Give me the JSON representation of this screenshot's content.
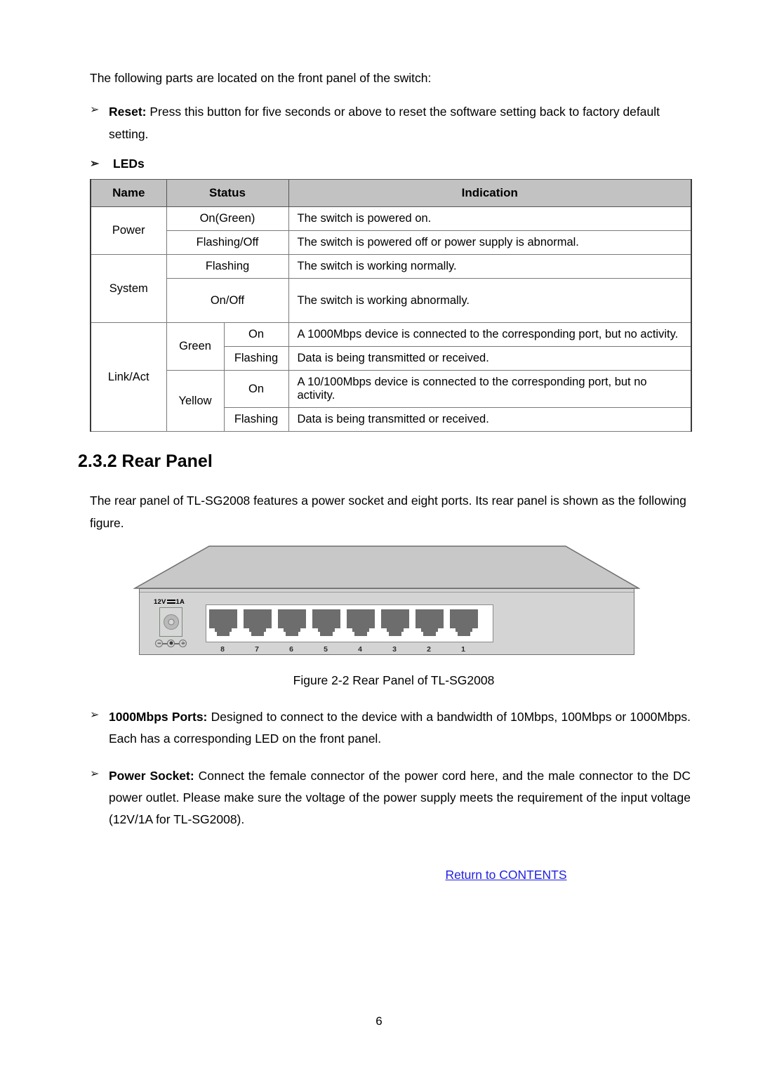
{
  "page": {
    "number": "6",
    "intro": "The following parts are located on the front panel of the switch:",
    "bullet_arrow": "➢"
  },
  "bullets_top": [
    {
      "label": "Reset:",
      "text": " Press this button for five seconds or above to reset the software setting back to factory default setting."
    },
    {
      "label": "LEDs",
      "text": ""
    }
  ],
  "led_table": {
    "headers": [
      "Name",
      "Status",
      "Indication"
    ],
    "rows": [
      {
        "name": "Power",
        "status": "On(Green)",
        "indication": "The switch is powered on."
      },
      {
        "name": "",
        "status": "Flashing/Off",
        "indication": "The switch is powered off or power supply is abnormal."
      },
      {
        "name": "System",
        "status": "Flashing",
        "indication": "The switch is working normally."
      },
      {
        "name": "",
        "status": "On/Off",
        "indication": "The switch is working abnormally."
      },
      {
        "name": "Link/Act",
        "color": "Green",
        "status": "On",
        "indication": "A 1000Mbps device is connected to the corresponding port, but no activity."
      },
      {
        "name": "",
        "color": "",
        "status": "Flashing",
        "indication": "Data is being transmitted or received."
      },
      {
        "name": "",
        "color": "Yellow",
        "status": "On",
        "indication": "A 10/100Mbps device is connected to the corresponding port, but no activity."
      },
      {
        "name": "",
        "color": "",
        "status": "Flashing",
        "indication": "Data is being transmitted or received."
      }
    ]
  },
  "section": {
    "heading": "2.3.2 Rear Panel",
    "paragraph": "The rear panel of TL-SG2008 features a power socket and eight ports. Its rear panel is shown as the following figure."
  },
  "figure": {
    "caption": "Figure 2-2 Rear Panel of TL-SG2008",
    "psu_label_prefix": "12V",
    "psu_label_suffix": "1A",
    "port_numbers": [
      "8",
      "7",
      "6",
      "5",
      "4",
      "3",
      "2",
      "1"
    ]
  },
  "bullets_bottom": [
    {
      "label": "1000Mbps Ports:",
      "text": " Designed to connect to the device with a bandwidth of 10Mbps, 100Mbps or 1000Mbps. Each has a corresponding LED on the front panel."
    },
    {
      "label": "Power Socket:",
      "text": " Connect the female connector of the power cord here, and the male connector to the DC power outlet. Please make sure the voltage of the power supply meets the requirement of the input voltage (12V/1A for TL-SG2008)."
    }
  ],
  "footer": {
    "contents_link": "Return to CONTENTS",
    "link_color": "#2020e0"
  }
}
